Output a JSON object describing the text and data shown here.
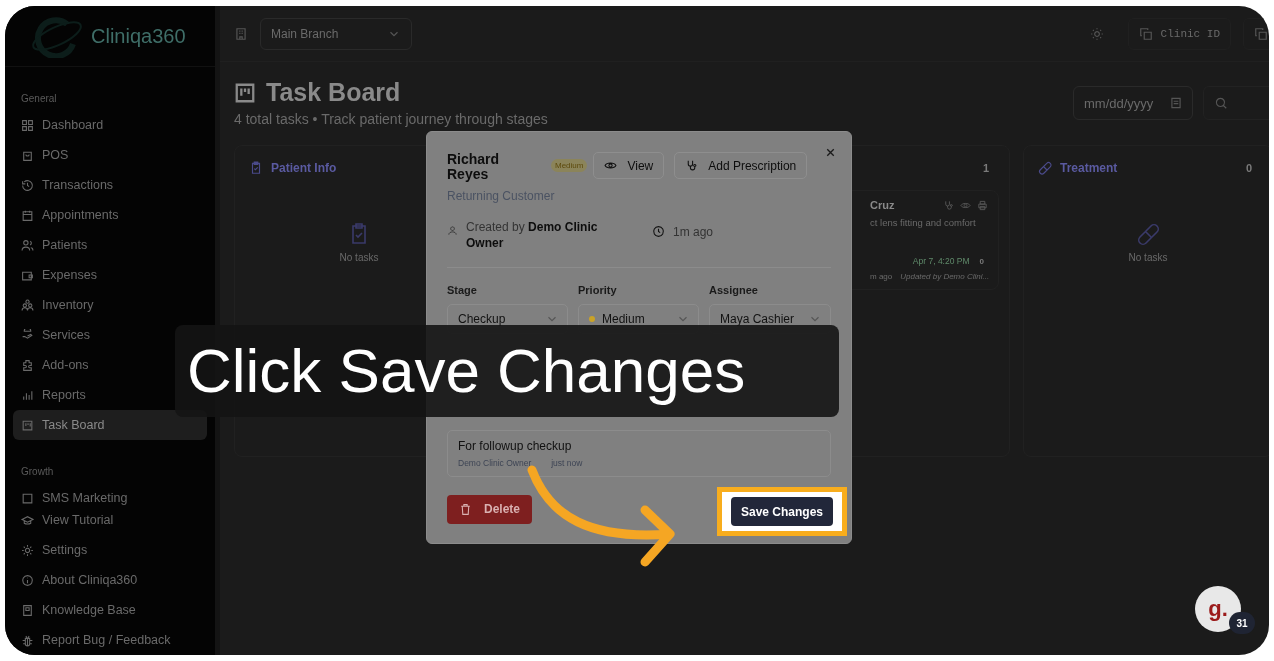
{
  "sidebar": {
    "logo": "Cliniqa360",
    "sections": [
      {
        "heading": "General",
        "items": [
          {
            "label": "Dashboard",
            "selected": false
          },
          {
            "label": "POS",
            "selected": false
          },
          {
            "label": "Transactions",
            "selected": false
          },
          {
            "label": "Appointments",
            "selected": false
          },
          {
            "label": "Patients",
            "selected": false
          },
          {
            "label": "Expenses",
            "selected": false
          },
          {
            "label": "Inventory",
            "selected": false
          },
          {
            "label": "Services",
            "selected": false
          },
          {
            "label": "Add-ons",
            "selected": false
          },
          {
            "label": "Reports",
            "selected": false
          },
          {
            "label": "Task Board",
            "selected": true
          }
        ]
      },
      {
        "heading": "Growth",
        "items": [
          {
            "label": "SMS Marketing",
            "selected": false
          }
        ]
      }
    ],
    "footer_items": [
      {
        "label": "View Tutorial"
      },
      {
        "label": "Settings"
      },
      {
        "label": "About Cliniqa360"
      },
      {
        "label": "Knowledge Base"
      },
      {
        "label": "Report Bug / Feedback"
      }
    ]
  },
  "topbar": {
    "branch": "Main Branch",
    "clinic_id_button": "Clinic ID"
  },
  "page": {
    "title": "Task Board",
    "subtitle": "4 total tasks • Track patient journey through stages",
    "date_field": {
      "placeholder": "mm/dd/yyyy"
    }
  },
  "columns": [
    {
      "title": "Patient Info",
      "empty_text": "No tasks"
    },
    {
      "count": "1",
      "card": {
        "name": "Cruz",
        "description": "ct lens fitting and comfort",
        "date": "Apr 7, 4:20 PM",
        "count": "0",
        "age": "m ago",
        "updated": "Updated by Demo Clini..."
      }
    },
    {
      "title": "Treatment",
      "count": "0",
      "empty_text": "No tasks"
    }
  ],
  "modal": {
    "title": "Richard Reyes",
    "badge": "Medium",
    "subtitle": "Returning Customer",
    "created": "Created by **Demo Clinic Owner**",
    "time": "1m ago",
    "actions": [
      "View",
      "Add Prescription"
    ],
    "fields": [
      {
        "label": "Stage",
        "value": "Checkup"
      },
      {
        "label": "Priority",
        "value": "Medium",
        "color": "#c9a227"
      },
      {
        "label": "Assignee",
        "value": "Maya Cashier"
      }
    ],
    "note": {
      "text": "For followup checkup",
      "author": "Demo Clinic Owner",
      "time": "just now"
    },
    "delete": "Delete",
    "save": "Save Changes"
  },
  "caption": "Click Save Changes",
  "help": {
    "logo": "g.",
    "badge": "31"
  }
}
